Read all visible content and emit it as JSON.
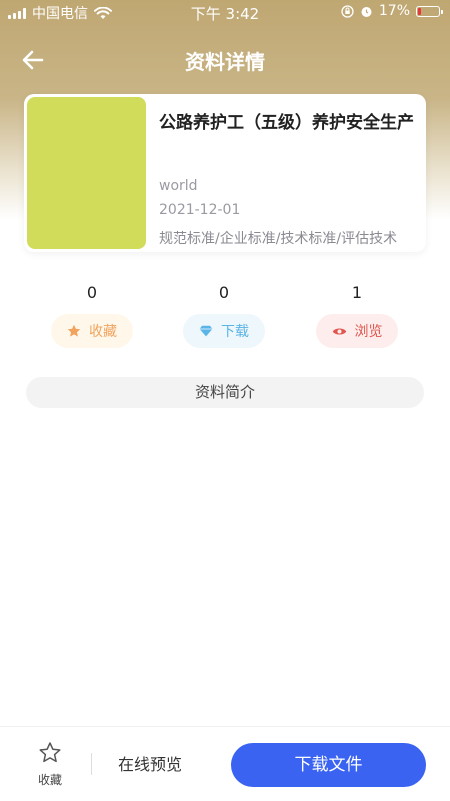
{
  "status_bar": {
    "carrier": "中国电信",
    "time": "下午 3:42",
    "battery_percent": "17%",
    "battery_level": 0.17,
    "icons": [
      "signal-icon",
      "wifi-icon",
      "orientation-lock-icon",
      "alarm-icon",
      "battery-icon"
    ]
  },
  "nav": {
    "title": "资料详情",
    "back_icon": "back-arrow-icon"
  },
  "card": {
    "title": "公路养护工（五级）养护安全生产",
    "author": "world",
    "date": "2021-12-01",
    "tags": "规范标准/企业标准/技术标准/评估技术",
    "cover_color": "#d1dc5a"
  },
  "stats": [
    {
      "count": "0",
      "label": "收藏",
      "icon": "star-icon",
      "color": "#f0a460",
      "bg": "#fff8ea"
    },
    {
      "count": "0",
      "label": "下载",
      "icon": "diamond-icon",
      "color": "#5ab4e6",
      "bg": "#eef7fc"
    },
    {
      "count": "1",
      "label": "浏览",
      "icon": "eye-icon",
      "color": "#e0574f",
      "bg": "#fdeeed"
    }
  ],
  "intro": {
    "label": "资料简介"
  },
  "bottom_bar": {
    "favorite_label": "收藏",
    "preview_label": "在线预览",
    "download_label": "下载文件",
    "accent": "#3a63f2"
  }
}
